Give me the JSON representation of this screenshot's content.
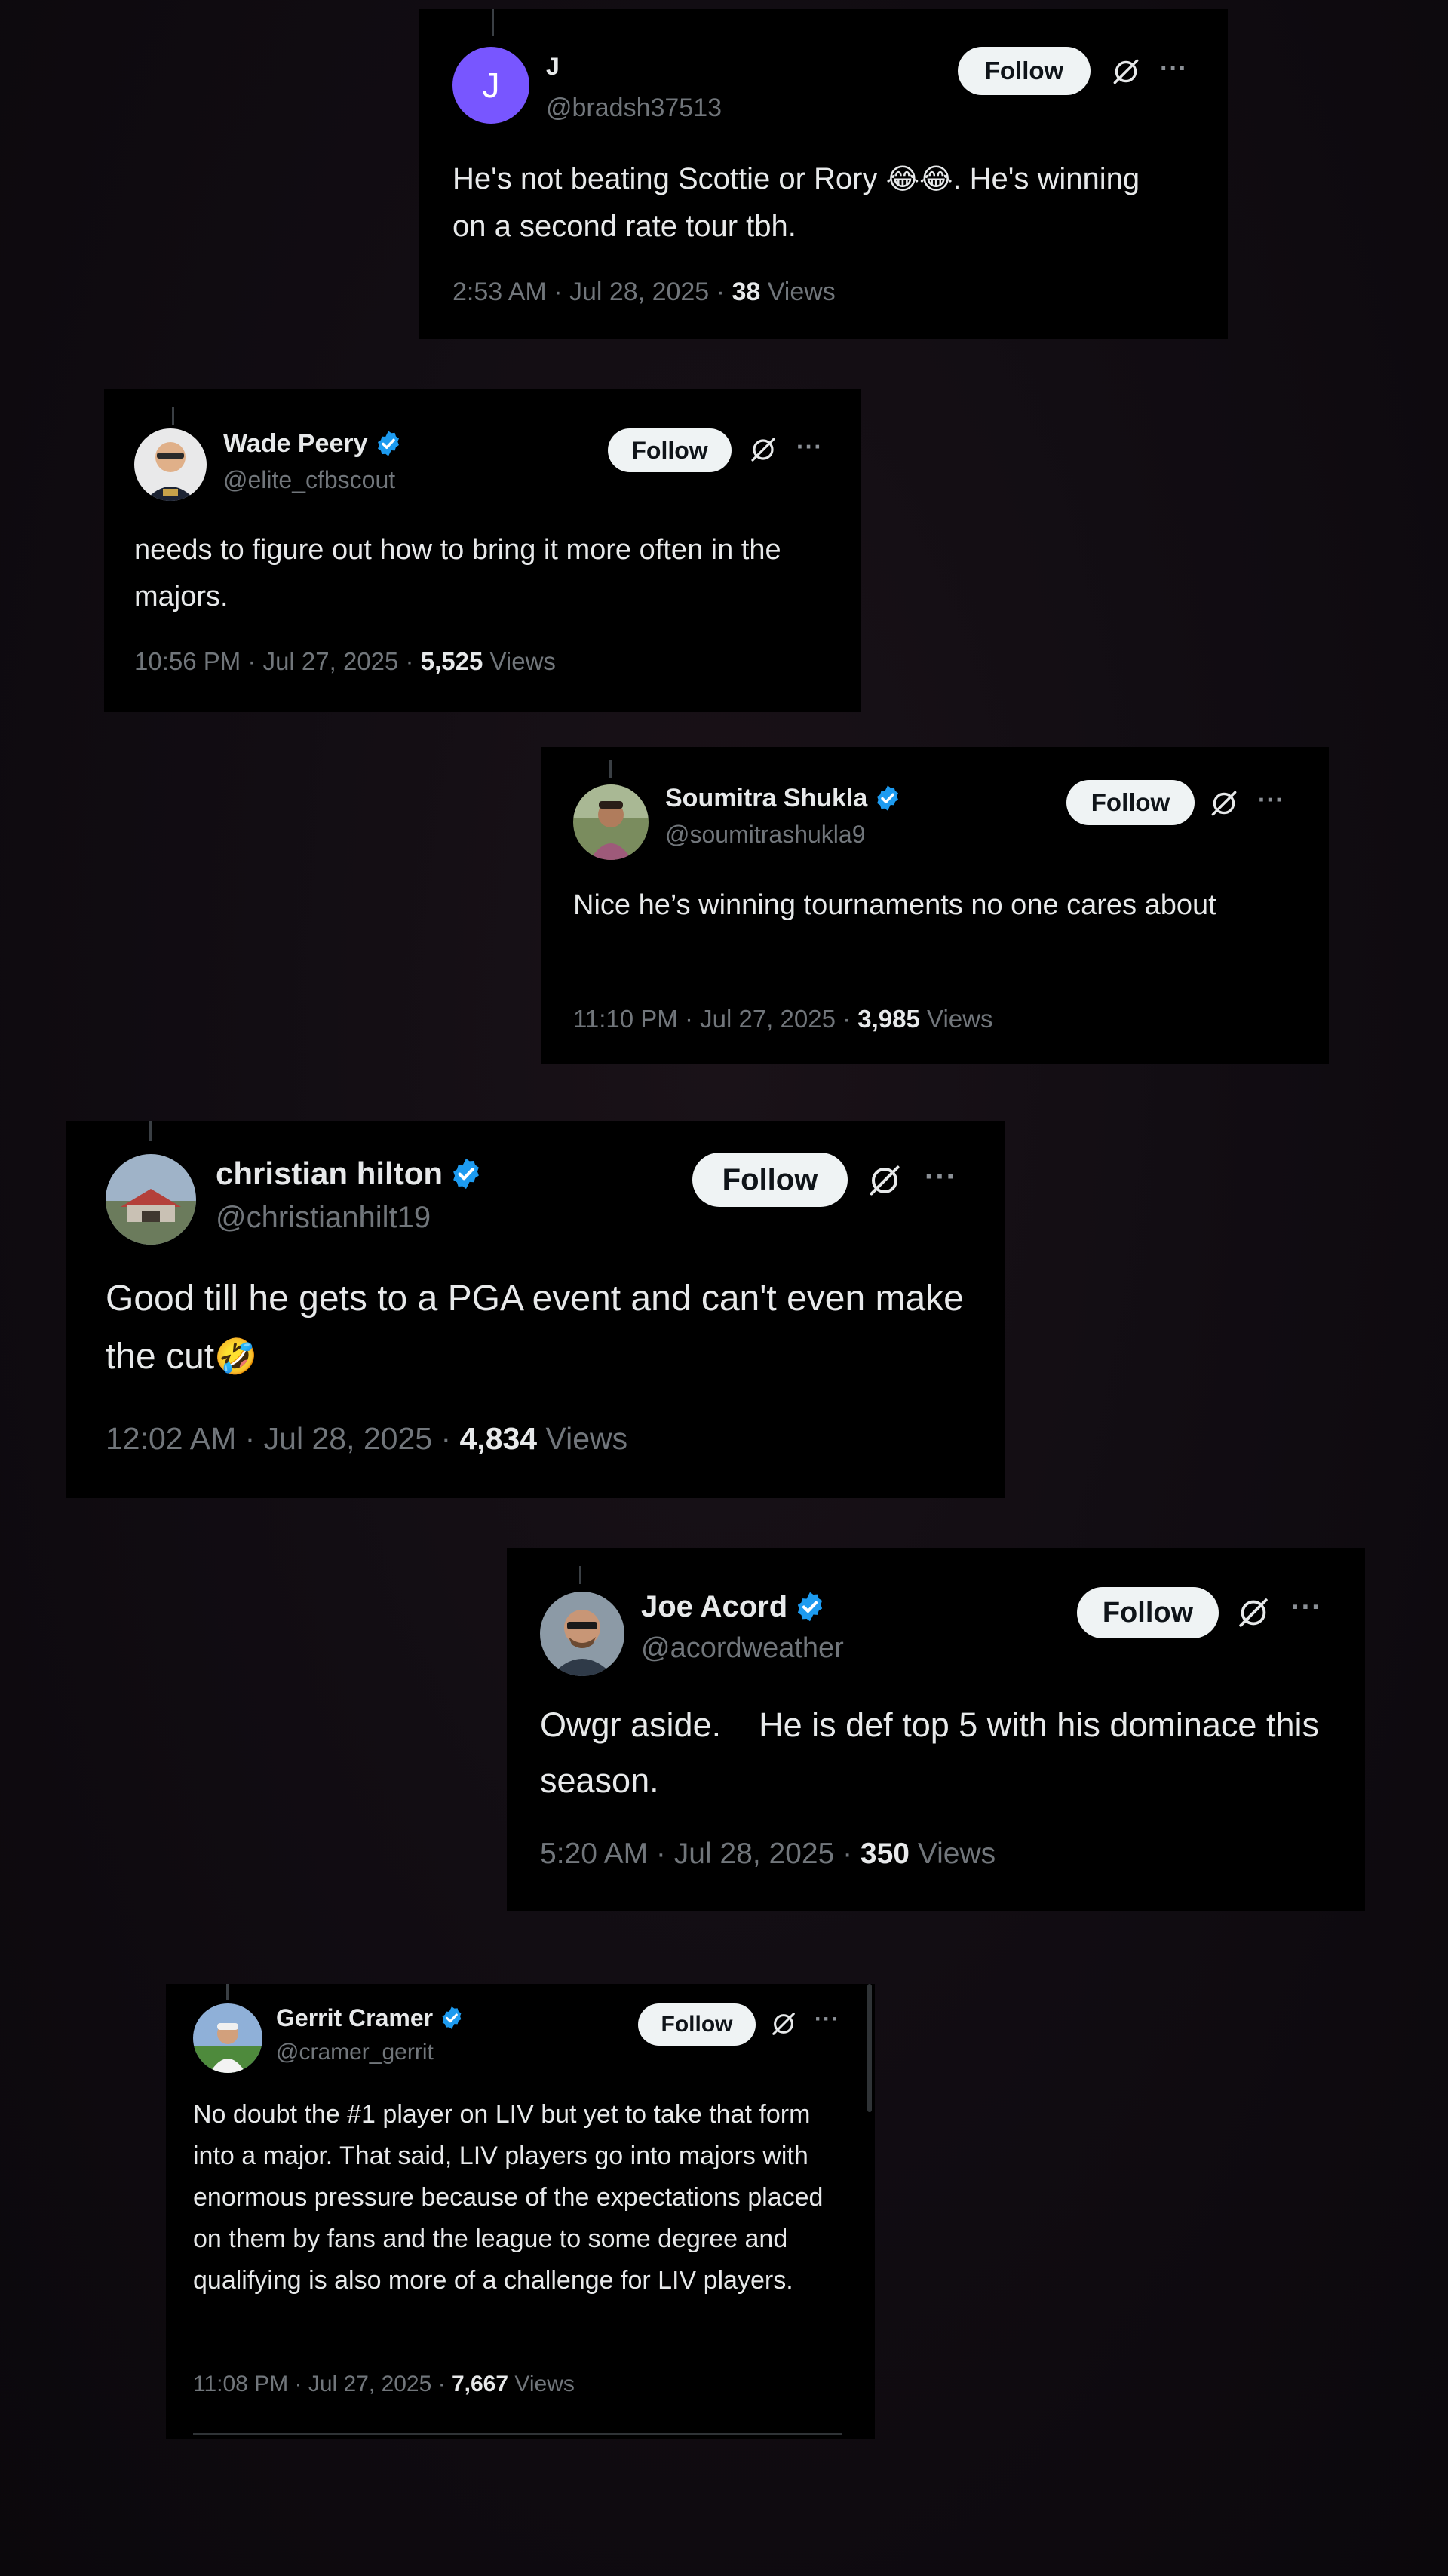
{
  "tweets": [
    {
      "name": "J",
      "handle": "@bradsh37513",
      "avatar_letter": "J",
      "avatar_color": "#7856ff",
      "verified": false,
      "follow_label": "Follow",
      "text_before_emoji": "He's not beating Scottie or Rory ",
      "emoji": "😂😂",
      "text_after_emoji": ". He's winning on a second rate tour tbh.",
      "time": "2:53 AM · Jul 28, 2025 · ",
      "views_count": "38",
      "views_label": " Views"
    },
    {
      "name": "Wade Peery",
      "handle": "@elite_cfbscout",
      "verified": true,
      "follow_label": "Follow",
      "text": "needs to figure out how to bring it more often in the majors.",
      "time": "10:56 PM · Jul 27, 2025 · ",
      "views_count": "5,525",
      "views_label": " Views"
    },
    {
      "name": "Soumitra Shukla",
      "handle": "@soumitrashukla9",
      "verified": true,
      "follow_label": "Follow",
      "text": "Nice he’s winning tournaments no one cares about",
      "time": "11:10 PM · Jul 27, 2025 · ",
      "views_count": "3,985",
      "views_label": " Views"
    },
    {
      "name": "christian hilton",
      "handle": "@christianhilt19",
      "verified": true,
      "follow_label": "Follow",
      "text": "Good till he gets to a PGA event and can't even make the cut",
      "emoji": "🤣",
      "time": "12:02 AM · Jul 28, 2025 · ",
      "views_count": "4,834",
      "views_label": " Views"
    },
    {
      "name": "Joe Acord",
      "handle": "@acordweather",
      "verified": true,
      "follow_label": "Follow",
      "text": "Owgr aside.    He is def top 5 with his dominace this season.",
      "time": "5:20 AM · Jul 28, 2025 · ",
      "views_count": "350",
      "views_label": " Views"
    },
    {
      "name": "Gerrit Cramer",
      "handle": "@cramer_gerrit",
      "verified": true,
      "follow_label": "Follow",
      "text": "No doubt the #1 player on LIV but yet to take that form into a major. That said, LIV players go into majors with enormous pressure because of the expectations placed on them by fans and the league to some degree and qualifying is also more of a challenge for LIV players.",
      "time": "11:08 PM · Jul 27, 2025 · ",
      "views_count": "7,667",
      "views_label": " Views"
    }
  ],
  "colors": {
    "verified_badge": "#1d9bf0",
    "card_background": "#000000",
    "secondary_text": "#71767b",
    "follow_button": "#eff3f4"
  }
}
